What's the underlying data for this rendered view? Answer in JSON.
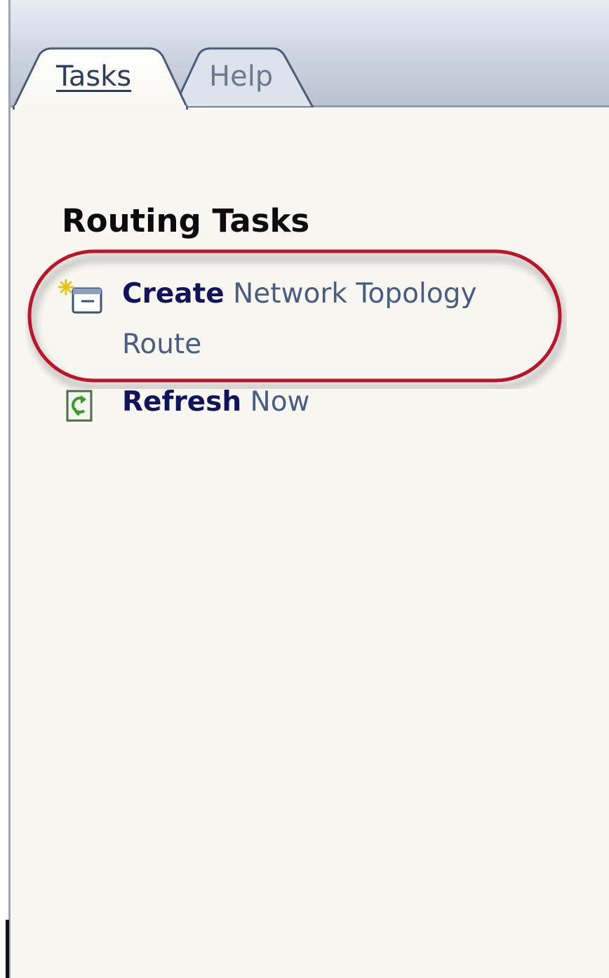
{
  "tabs": [
    {
      "label": "Tasks",
      "active": true
    },
    {
      "label": "Help",
      "active": false
    }
  ],
  "section": {
    "title": "Routing Tasks"
  },
  "tasks": [
    {
      "verb": "Create",
      "rest": " Network Topology Route",
      "icon": "new-item-icon"
    },
    {
      "verb": "Refresh",
      "rest": " Now",
      "icon": "refresh-icon"
    }
  ],
  "colors": {
    "link_verb": "#12145a",
    "link_text": "#4a5d80",
    "highlight": "#b8142c",
    "panel_bg": "#f8f7f2"
  }
}
